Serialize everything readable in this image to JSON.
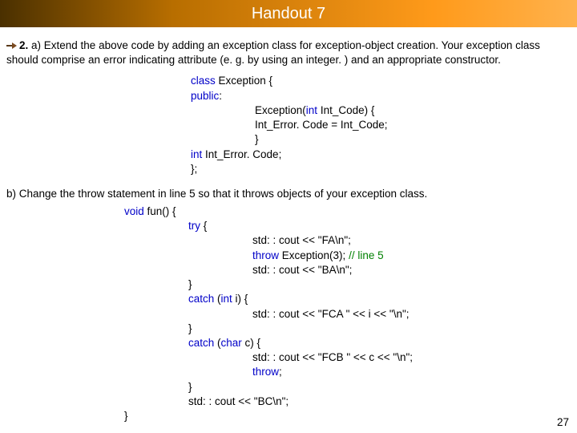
{
  "title": "Handout 7",
  "page_number": "27",
  "bullet_number": "2.",
  "part_a_text": " a) Extend the above code by adding an exception class for exception-object creation. Your exception class should comprise an error indicating attribute (e. g. by using an integer. ) and an appropriate constructor.",
  "code_a": {
    "l1_kw": "class",
    "l1_rest": " Exception {",
    "l2_kw": "public",
    "l2_rest": ":",
    "l3a": "Exception(",
    "l3_kw": "int",
    "l3b": " Int_Code) {",
    "l4": "Int_Error. Code = Int_Code;",
    "l5": "}",
    "l6_kw": "int",
    "l6_rest": " Int_Error. Code;",
    "l7": "};"
  },
  "part_b_text": "b) Change the throw statement in line 5 so that it throws objects of your exception class.",
  "code_b": {
    "l1_kw": "void",
    "l1_rest": " fun() {",
    "l2_kw": "try",
    "l2_rest": " {",
    "l3": "std: : cout << \"FA\\n\";",
    "l4_kw": "throw",
    "l4_rest": " Exception(3); ",
    "l4_cm": "// line 5",
    "l5": "std: : cout << \"BA\\n\";",
    "l6": "}",
    "l7_kw": "catch",
    "l7a": " (",
    "l7_kw2": "int",
    "l7b": " i) {",
    "l8": "std: : cout << \"FCA \" << i << \"\\n\";",
    "l9": "}",
    "l10_kw": "catch",
    "l10a": " (",
    "l10_kw2": "char",
    "l10b": " c) {",
    "l11": "std: : cout << \"FCB \" << c << \"\\n\";",
    "l12_kw": "throw",
    "l12_rest": ";",
    "l13": "}",
    "l14": "std: : cout << \"BC\\n\";",
    "l15": "}"
  }
}
